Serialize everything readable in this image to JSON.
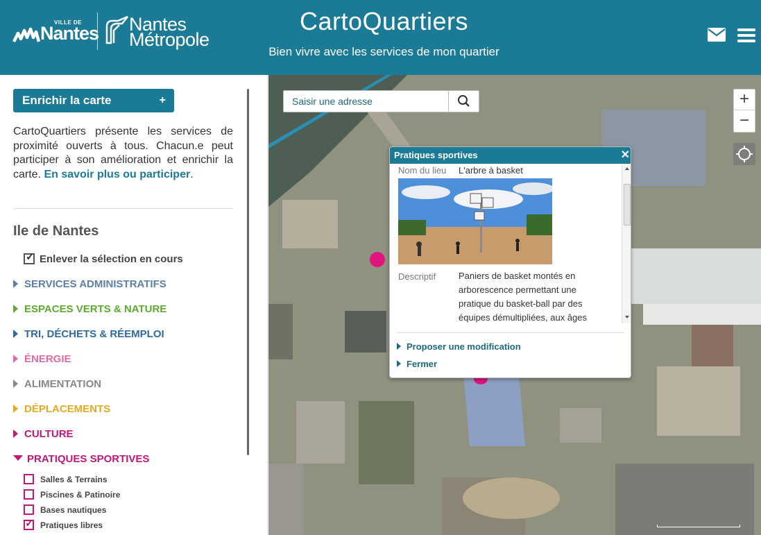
{
  "header": {
    "logo_ville_small": "VILLE DE",
    "logo_nantes": "Nantes",
    "logo_metro_line1": "Nantes",
    "logo_metro_line2": "Métropole",
    "title": "CartoQuartiers",
    "subtitle": "Bien vivre avec les services de mon quartier",
    "icons": [
      "mail-icon",
      "menu-icon"
    ]
  },
  "sidebar": {
    "enrich_button": "Enrichir la carte",
    "enrich_plus": "+",
    "intro_text": "CartoQuartiers présente les services de proximité ouverts à tous. Chacun.e peut participer à son amélioration et enrichir la carte.",
    "intro_link": "En savoir plus ou participer",
    "intro_end": ".",
    "zone_title": "Ile de Nantes",
    "clear_selection": "Enlever la sélection en cours",
    "categories": [
      {
        "label": "SERVICES ADMINISTRATIFS",
        "color": "#5b7fa6"
      },
      {
        "label": "ESPACES VERTS & NATURE",
        "color": "#5cab2f"
      },
      {
        "label": "TRI, DÉCHETS & RÉEMPLOI",
        "color": "#2f6aa0"
      },
      {
        "label": "ÉNERGIE",
        "color": "#e06aa6"
      },
      {
        "label": "ALIMENTATION",
        "color": "#888888"
      },
      {
        "label": "DÉPLACEMENTS",
        "color": "#e6a91b"
      },
      {
        "label": "CULTURE",
        "color": "#c0177c"
      },
      {
        "label": "PRATIQUES SPORTIVES",
        "color": "#c0177c"
      }
    ],
    "subcategories": [
      {
        "label": "Salles & Terrains",
        "checked": false
      },
      {
        "label": "Piscines & Patinoire",
        "checked": false
      },
      {
        "label": "Bases nautiques",
        "checked": false
      },
      {
        "label": "Pratiques libres",
        "checked": true
      }
    ]
  },
  "map": {
    "search_placeholder": "Saisir une adresse",
    "zoom_in": "+",
    "zoom_out": "−",
    "icons": [
      "search-icon",
      "locate-icon"
    ]
  },
  "popup": {
    "title": "Pratiques sportives",
    "close": "✕",
    "name_label": "Nom du lieu",
    "name_value": "L'arbre à basket",
    "desc_label": "Descriptif",
    "desc_value": "Paniers de basket montés en arborescence permettant une pratique du basket-ball par des équipes démultipliées, aux âges",
    "link_modify": "Proposer une modification",
    "link_close": "Fermer"
  },
  "colors": {
    "brand": "#1b7a96",
    "marker": "#e0157e"
  }
}
